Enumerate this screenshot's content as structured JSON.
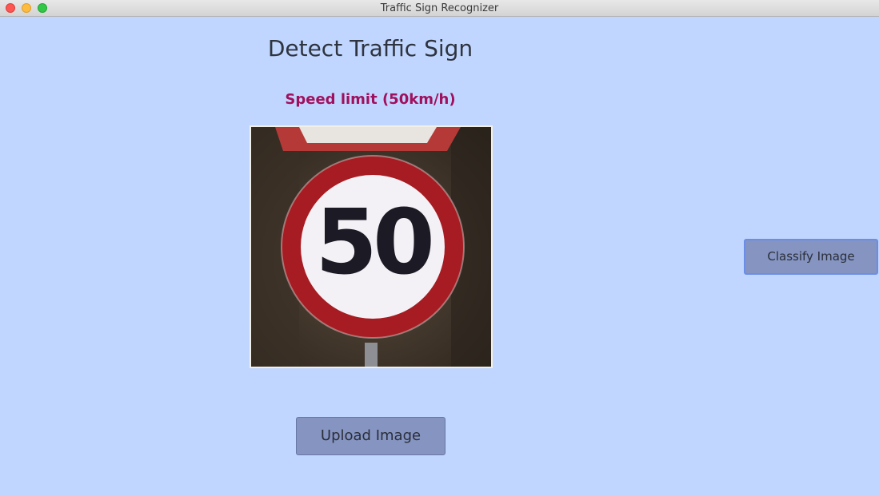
{
  "window": {
    "title": "Traffic Sign Recognizer"
  },
  "main": {
    "heading": "Detect Traffic Sign",
    "prediction": "Speed limit (50km/h)",
    "image": {
      "sign_text": "50"
    },
    "upload_label": "Upload Image",
    "classify_label": "Classify Image"
  },
  "colors": {
    "background": "#c1d6fe",
    "prediction": "#a0105e",
    "button": "#8594c1",
    "sign_red": "#a61c22"
  }
}
